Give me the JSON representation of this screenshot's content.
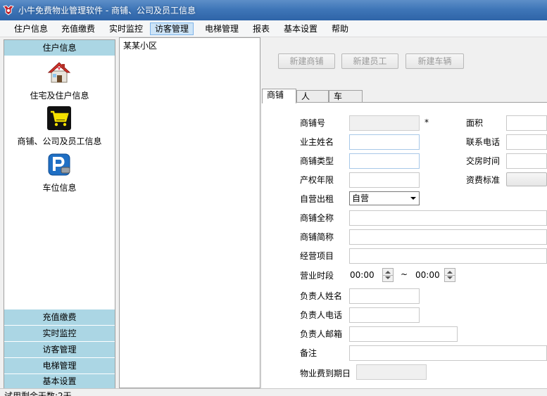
{
  "window": {
    "title": "小牛免费物业管理软件 - 商铺、公司及员工信息"
  },
  "menu": [
    "住户信息",
    "充值缴费",
    "实时监控",
    "访客管理",
    "电梯管理",
    "报表",
    "基本设置",
    "帮助"
  ],
  "sidebar": {
    "header": "住户信息",
    "entries": [
      {
        "label": "住宅及住户信息",
        "icon": "house-icon"
      },
      {
        "label": "商铺、公司及员工信息",
        "icon": "shopping-cart-icon"
      },
      {
        "label": "车位信息",
        "icon": "parking-icon"
      }
    ],
    "groups": [
      "充值缴费",
      "实时监控",
      "访客管理",
      "电梯管理",
      "基本设置"
    ]
  },
  "tree": {
    "root": "某某小区"
  },
  "toolbar": {
    "new_shop": "新建商铺",
    "new_employee": "新建员工",
    "new_vehicle": "新建车辆"
  },
  "tabs": [
    "商铺",
    "人",
    "车"
  ],
  "form": {
    "shop_no": "商铺号",
    "required_mark": "*",
    "area": "面积",
    "owner_name": "业主姓名",
    "phone": "联系电话",
    "shop_type": "商铺类型",
    "handover_time": "交房时间",
    "property_years": "产权年限",
    "fee_standard": "资费标准",
    "self_rent": "自营出租",
    "self_rent_value": "自营",
    "full_name": "商铺全称",
    "short_name": "商铺简称",
    "business": "经营项目",
    "hours": "营业时段",
    "hours_start": "00:00",
    "hours_sep": "~",
    "hours_end": "00:00",
    "manager_name": "负责人姓名",
    "manager_phone": "负责人电话",
    "manager_email": "负责人邮箱",
    "remark": "备注",
    "fee_due": "物业费到期日"
  },
  "status": {
    "text": "试用剩余天数:2天"
  }
}
